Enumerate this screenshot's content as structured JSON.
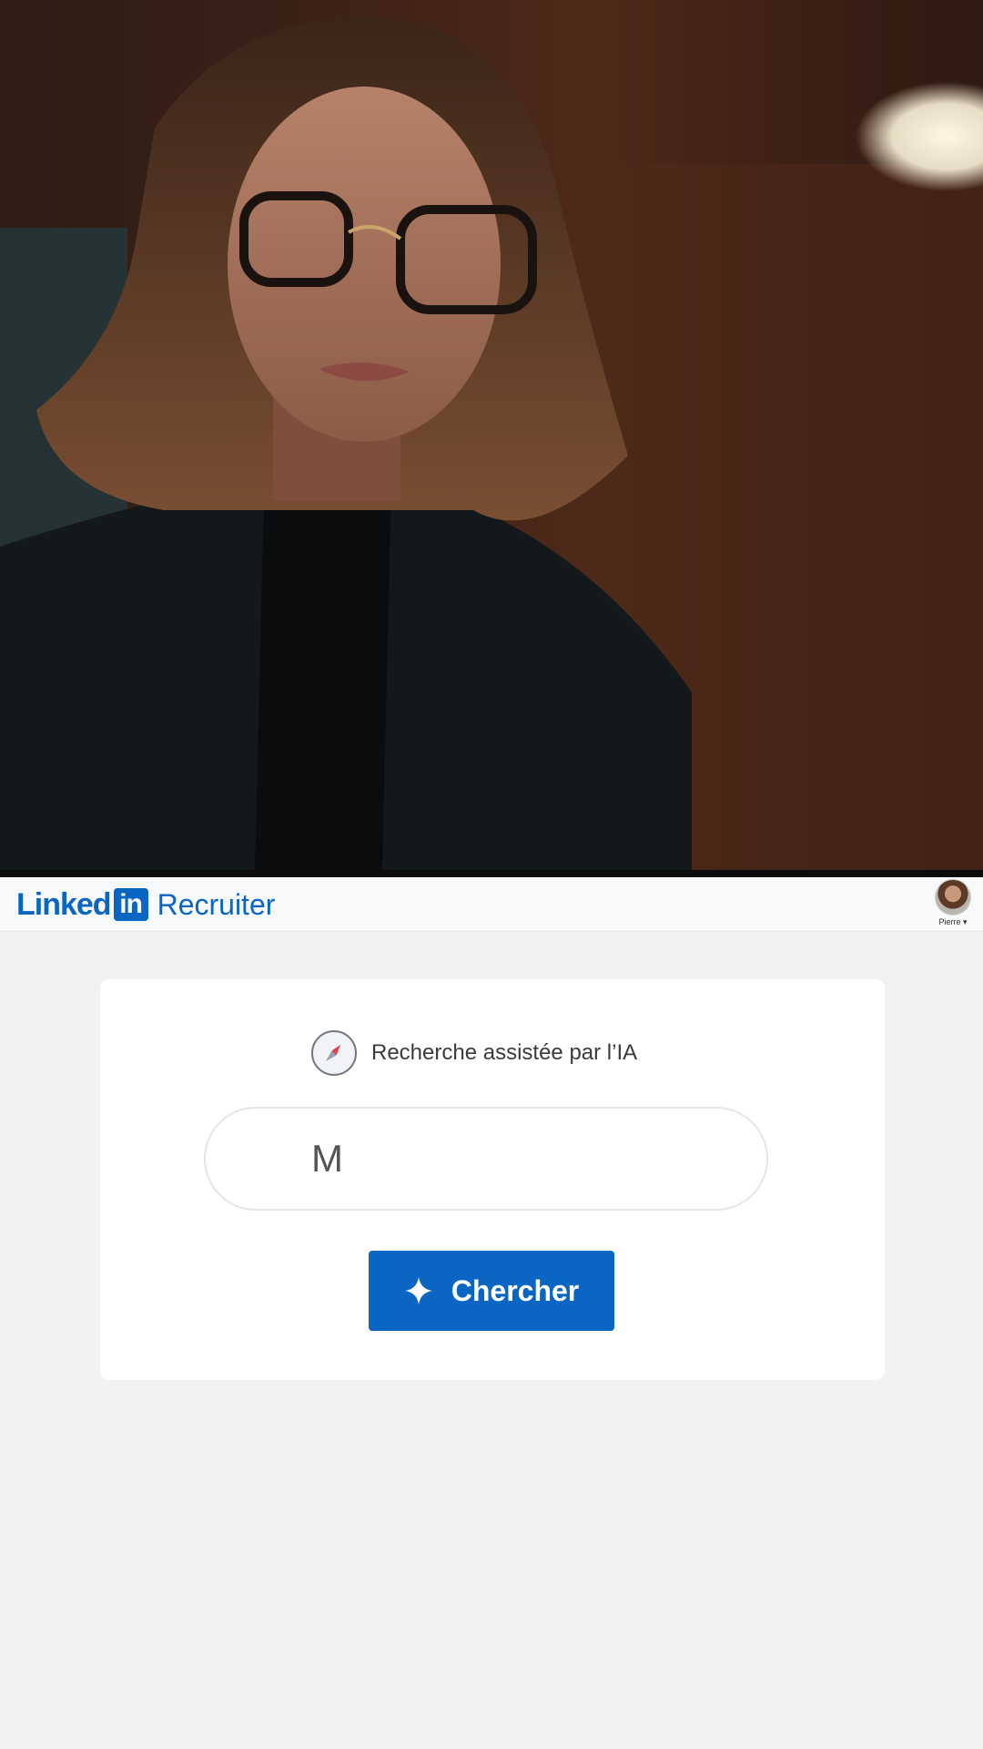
{
  "header": {
    "logo_linked": "Linked",
    "logo_in": "in",
    "logo_product": "Recruiter",
    "profile_name": "Pierre ▾"
  },
  "search": {
    "ai_label": "Recherche assistée par l’IA",
    "input_value": "M",
    "button_label": "Chercher"
  },
  "colors": {
    "brand": "#0a66c2",
    "page_background": "#f3f2f0",
    "card_background": "#ffffff"
  },
  "icons": {
    "ai": "compass-icon",
    "button": "sparkle-icon"
  }
}
